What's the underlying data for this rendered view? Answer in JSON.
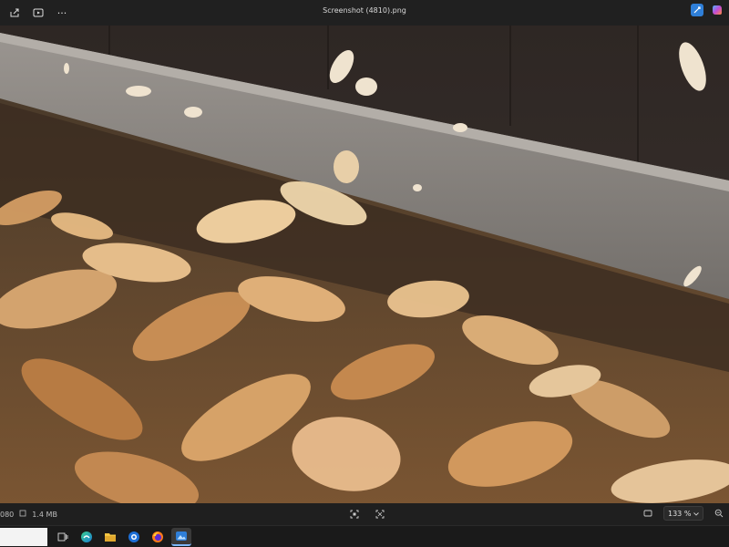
{
  "window": {
    "title": "Screenshot (4810).png"
  },
  "toolbar": {
    "more_glyph": "···"
  },
  "statusbar": {
    "dimensions_partial": "080",
    "file_size": "1.4 MB",
    "zoom": "133 %"
  },
  "colors": {
    "background": "#1c1c1c",
    "accent": "#2f7fd8"
  },
  "icons": {
    "share": "share-icon",
    "slideshow": "slideshow-icon",
    "more": "more-icon",
    "editor": "editor-app-icon",
    "copilot": "copilot-icon",
    "fit": "fit-to-window-icon",
    "actual": "actual-size-icon",
    "fullscreen": "fullscreen-icon",
    "zoom": "zoom-out-icon"
  },
  "taskbar": {
    "apps": [
      "task-view",
      "edge",
      "file-explorer",
      "store",
      "firefox",
      "photos"
    ]
  }
}
